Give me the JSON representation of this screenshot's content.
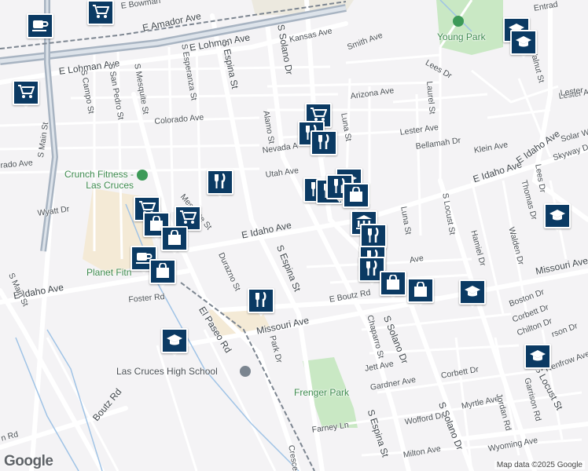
{
  "map": {
    "streets": [
      "E Bowman",
      "E Amador Ave",
      "E Lohman Ave",
      "E Lohman Ave",
      "Kansas Ave",
      "Smith Ave",
      "Lees Dr",
      "Entrad",
      "Walnut St",
      "S Campo St",
      "S San Pedro St",
      "S Mesquite St",
      "S Esperanza St",
      "S Espina St",
      "S Solano Dr",
      "Arizona Ave",
      "Laurel St",
      "Lester Ave",
      "Colorado Ave",
      "Alamo St",
      "Nevada A",
      "Luna St",
      "Lester Ave",
      "Bellamah Dr",
      "Klein Ave",
      "Solar W",
      "Skyway Dr",
      "E Idaho Ave",
      "E Idaho Ave",
      "Lees Dr",
      "Utah Ave",
      "Mesquite St",
      "Wyatt Dr",
      "S Main St",
      "rado Ave",
      "E Idaho Ave",
      "S Locust St",
      "Thomas Dr",
      "Luna St",
      "Hamiel Dr",
      "Walden Dr",
      "Durazno St",
      "S Espina St",
      "Ave",
      "Missouri Ave",
      "Missouri Ave",
      "E Idaho Ave",
      "Foster Rd",
      "E Boutz Rd",
      "S Solano Dr",
      "Chaparro St",
      "Boston Dr",
      "Corbett Dr",
      "Chilton Dr",
      "rson Dr",
      "Renfrow Ave",
      "El Paseo Rd",
      "Park Dr",
      "Jett Ave",
      "S Main St",
      "Corbett Dr",
      "S Locust St",
      "Gardner Ave",
      "Myrtle Ave",
      "Jordan Rd",
      "Garrison Rd",
      "S Espina St",
      "Wofford Dr",
      "S Solano Dr",
      "Boutz Rd",
      "Farney Ln",
      "Wyoming Ave",
      "Milton Ave",
      "Cresce",
      "n Rd",
      "Lester"
    ],
    "places": [
      "Young Park",
      "Crunch Fitness - Las Cruces",
      "Planet Fitn",
      "Las Cruces High School",
      "Frenger Park"
    ],
    "markers": [
      {
        "icon": "shopping-cart-icon"
      },
      {
        "icon": "coffee-cup-icon"
      },
      {
        "icon": "shopping-cart-icon"
      },
      {
        "icon": "graduation-cap-icon"
      },
      {
        "icon": "graduation-cap-icon"
      },
      {
        "icon": "shopping-cart-icon"
      },
      {
        "icon": "restaurant-icon"
      },
      {
        "icon": "restaurant-icon"
      },
      {
        "icon": "restaurant-icon"
      },
      {
        "icon": "graduation-cap-icon"
      },
      {
        "icon": "restaurant-icon"
      },
      {
        "icon": "restaurant-icon"
      },
      {
        "icon": "restaurant-icon"
      },
      {
        "icon": "shopping-bag-icon"
      },
      {
        "icon": "shopping-cart-icon"
      },
      {
        "icon": "shopping-cart-icon"
      },
      {
        "icon": "shopping-bag-icon"
      },
      {
        "icon": "shopping-bag-icon"
      },
      {
        "icon": "bank-icon"
      },
      {
        "icon": "restaurant-icon"
      },
      {
        "icon": "graduation-cap-icon"
      },
      {
        "icon": "restaurant-icon"
      },
      {
        "icon": "restaurant-icon"
      },
      {
        "icon": "shopping-bag-icon"
      },
      {
        "icon": "shopping-bag-icon"
      },
      {
        "icon": "coffee-cup-icon"
      },
      {
        "icon": "shopping-bag-icon"
      },
      {
        "icon": "graduation-cap-icon"
      },
      {
        "icon": "restaurant-icon"
      },
      {
        "icon": "graduation-cap-icon"
      },
      {
        "icon": "graduation-cap-icon"
      }
    ],
    "branding": {
      "logo": "Google",
      "attribution": "Map data ©2025 Google"
    },
    "colors": {
      "marker": "#0b3a63",
      "park": "#c9e8c4",
      "road": "#ffffff",
      "highway": "#9aa8b8",
      "railway": "#7c8590"
    }
  }
}
